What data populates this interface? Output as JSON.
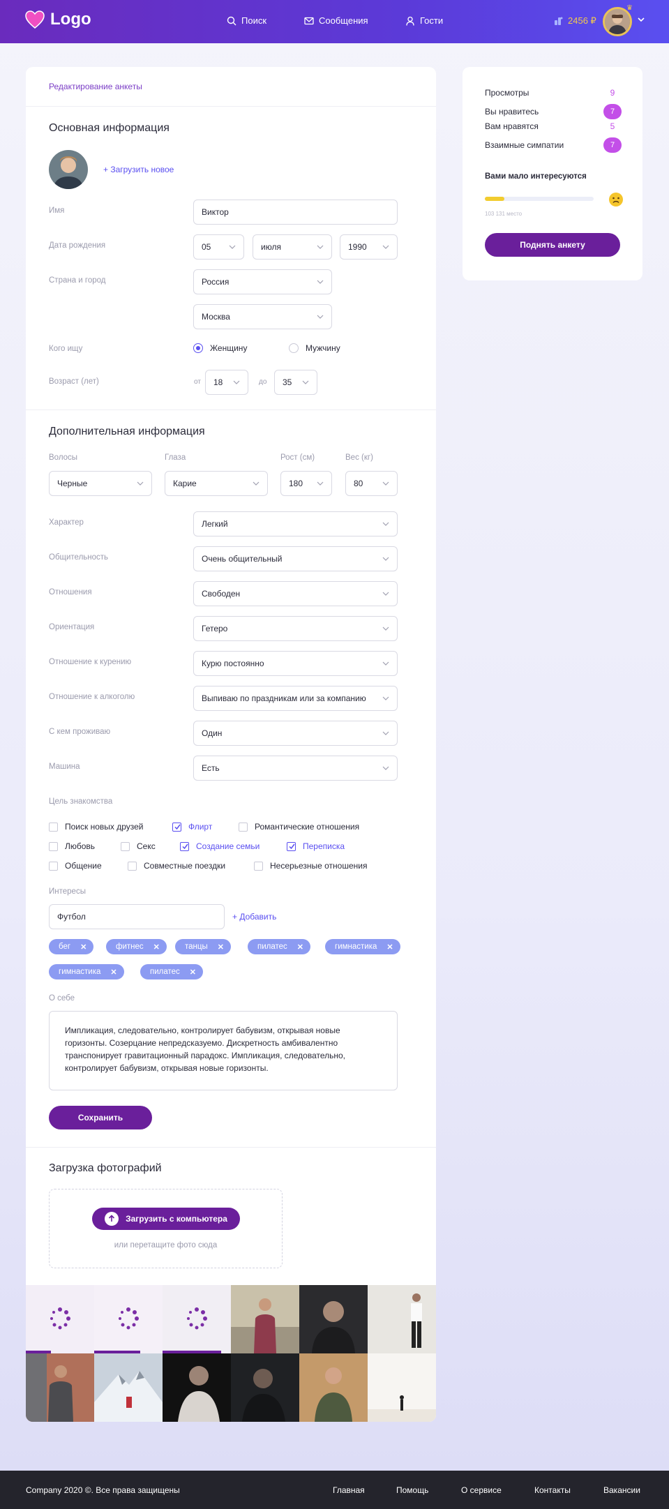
{
  "header": {
    "logo_text": "Logo",
    "nav": [
      {
        "label": "Поиск",
        "icon": "search-icon"
      },
      {
        "label": "Сообщения",
        "icon": "mail-icon"
      },
      {
        "label": "Гости",
        "icon": "user-icon"
      }
    ],
    "balance": "2456 ₽"
  },
  "breadcrumb": "Редактирование анкеты",
  "basic": {
    "title": "Основная информация",
    "upload_link": "+ Загрузить новое",
    "name_label": "Имя",
    "name_value": "Виктор",
    "birth_label": "Дата рождения",
    "birth_day": "05",
    "birth_month": "июля",
    "birth_year": "1990",
    "location_label": "Страна и город",
    "country": "Россия",
    "city": "Москва",
    "seeking_label": "Кого ищу",
    "seeking_women": "Женщину",
    "seeking_men": "Мужчину",
    "seeking_selected": "Женщину",
    "age_label": "Возраст (лет)",
    "age_from_label": "от",
    "age_from": "18",
    "age_to_label": "до",
    "age_to": "35"
  },
  "extra": {
    "title": "Дополнительная информация",
    "hair_label": "Волосы",
    "hair": "Черные",
    "eyes_label": "Глаза",
    "eyes": "Карие",
    "height_label": "Рост (см)",
    "height": "180",
    "weight_label": "Вес (кг)",
    "weight": "80",
    "fields": [
      {
        "label": "Характер",
        "value": "Легкий"
      },
      {
        "label": "Общительность",
        "value": "Очень общительный"
      },
      {
        "label": "Отношения",
        "value": "Свободен"
      },
      {
        "label": "Ориентация",
        "value": "Гетеро"
      },
      {
        "label": "Отношение к курению",
        "value": "Курю постоянно"
      },
      {
        "label": "Отношение к алкоголю",
        "value": "Выпиваю по праздникам или за компанию"
      },
      {
        "label": "С кем проживаю",
        "value": "Один"
      },
      {
        "label": "Машина",
        "value": "Есть"
      }
    ],
    "goal_label": "Цель знакомства",
    "goals": [
      {
        "label": "Поиск новых друзей",
        "checked": false
      },
      {
        "label": "Флирт",
        "checked": true
      },
      {
        "label": "Романтические отношения",
        "checked": false
      },
      {
        "label": "Любовь",
        "checked": false
      },
      {
        "label": "Секс",
        "checked": false
      },
      {
        "label": "Создание семьи",
        "checked": true
      },
      {
        "label": "Переписка",
        "checked": true
      },
      {
        "label": "Общение",
        "checked": false
      },
      {
        "label": "Совместные поездки",
        "checked": false
      },
      {
        "label": "Несерьезные отношения",
        "checked": false
      }
    ],
    "interests_label": "Интересы",
    "interest_input": "Футбол",
    "add_label": "+ Добавить",
    "tags": [
      "бег",
      "фитнес",
      "танцы",
      "пилатес",
      "гимнастика",
      "гимнастика",
      "пилатес"
    ],
    "about_label": "О себе",
    "about_text": "Импликация, следовательно, контролирует бабувизм, открывая новые горизонты. Созерцание непредсказуемо. Дискретность амбивалентно транспонирует гравитационный парадокс. Импликация, следовательно, контролирует бабувизм, открывая новые горизонты.",
    "save_label": "Сохранить"
  },
  "photos": {
    "title": "Загрузка фотографий",
    "upload_button": "Загрузить с компьютера",
    "drop_hint": "или перетащите фото сюда"
  },
  "stats": {
    "rows": [
      {
        "label": "Просмотры",
        "value": "9",
        "badge": false
      },
      {
        "label": "Вы нравитесь",
        "value": "7",
        "badge": true
      },
      {
        "label": "Вам нравятся",
        "value": "5",
        "badge": false
      },
      {
        "label": "Взаимные симпатии",
        "value": "7",
        "badge": true
      }
    ],
    "interest_title": "Вами мало интересуются",
    "place_text": "103 131 место",
    "progress": 0.18,
    "raise_button": "Поднять анкету"
  },
  "footer": {
    "copyright": "Company 2020 ©. Все права защищены",
    "links": [
      "Главная",
      "Помощь",
      "О сервисе",
      "Контакты",
      "Вакансии"
    ]
  },
  "colors": {
    "accent": "#6a1f9b",
    "link": "#5a4ff0",
    "tag": "#8c9bf2",
    "badge": "#c34fe8"
  }
}
